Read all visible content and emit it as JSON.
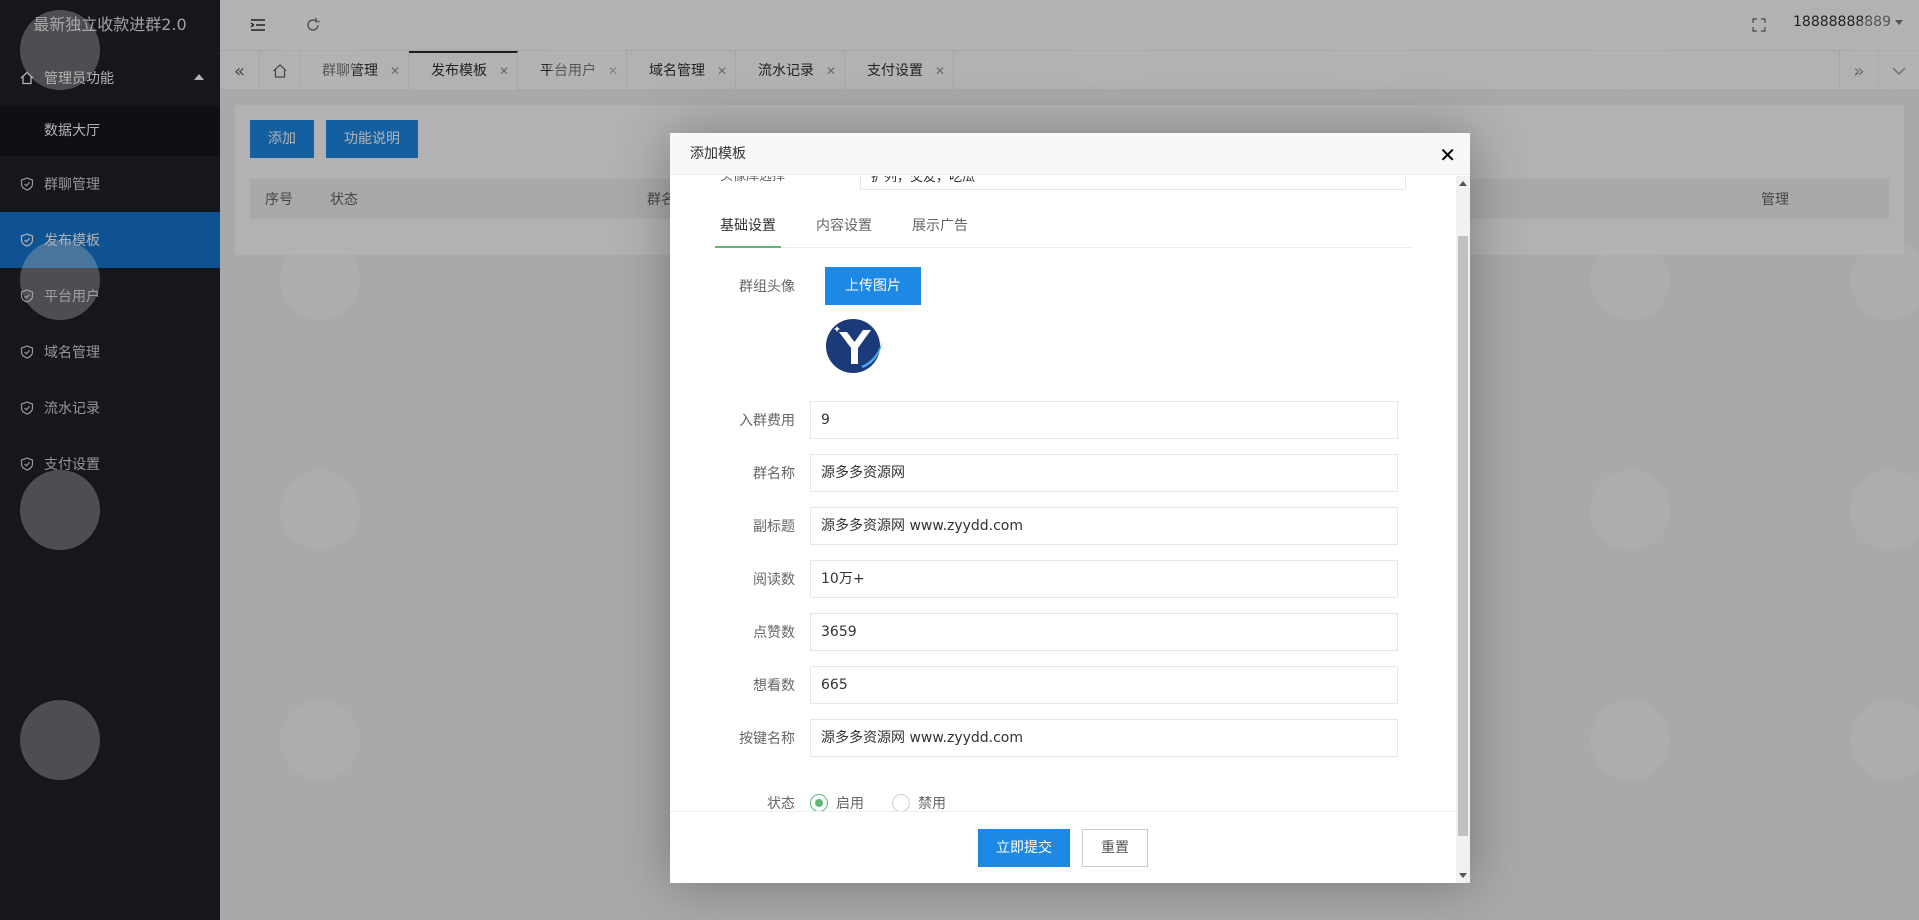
{
  "app": {
    "title": "最新独立收款进群2.0"
  },
  "sidebar": {
    "group": {
      "label": "管理员功能"
    },
    "sub": {
      "label": "数据大厅"
    },
    "items": [
      {
        "label": "群聊管理"
      },
      {
        "label": "发布模板"
      },
      {
        "label": "平台用户"
      },
      {
        "label": "域名管理"
      },
      {
        "label": "流水记录"
      },
      {
        "label": "支付设置"
      }
    ]
  },
  "header": {
    "user": "18888888889"
  },
  "tabs": [
    {
      "label": "群聊管理"
    },
    {
      "label": "发布模板"
    },
    {
      "label": "平台用户"
    },
    {
      "label": "域名管理"
    },
    {
      "label": "流水记录"
    },
    {
      "label": "支付设置"
    }
  ],
  "content": {
    "add_button": "添加",
    "help_button": "功能说明",
    "columns": {
      "index": "序号",
      "status": "状态",
      "name": "群名称",
      "manage": "管理"
    }
  },
  "modal": {
    "title": "添加模板",
    "cut_label": "头像库选择",
    "cut_value": "扩列，交友，吃瓜",
    "tabs": [
      {
        "label": "基础设置"
      },
      {
        "label": "内容设置"
      },
      {
        "label": "展示广告"
      }
    ],
    "avatar_label": "群组头像",
    "upload_button": "上传图片",
    "fields": [
      {
        "label": "入群费用",
        "value": "9"
      },
      {
        "label": "群名称",
        "value": "源多多资源网"
      },
      {
        "label": "副标题",
        "value": "源多多资源网 www.zyydd.com"
      },
      {
        "label": "阅读数",
        "value": "10万+"
      },
      {
        "label": "点赞数",
        "value": "3659"
      },
      {
        "label": "想看数",
        "value": "665"
      },
      {
        "label": "按键名称",
        "value": "源多多资源网 www.zyydd.com"
      }
    ],
    "status": {
      "label": "状态",
      "on": "启用",
      "off": "禁用",
      "selected": "启用"
    },
    "submit": "立即提交",
    "reset": "重置"
  },
  "colors": {
    "sidebar": "#20222a",
    "accent": "#1676d2",
    "radio": "#5fb878"
  }
}
